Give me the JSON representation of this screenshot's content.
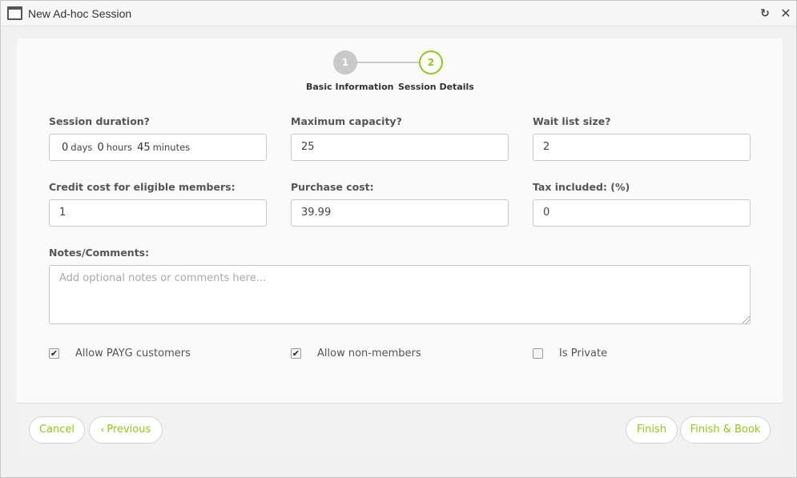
{
  "window": {
    "title": "New Ad-hoc Session",
    "icon": "window-icon",
    "refresh_icon": "refresh-icon",
    "close_icon": "close-icon",
    "refresh_glyph": "↻",
    "close_glyph": "✕"
  },
  "stepper": {
    "steps": [
      {
        "number": "1",
        "label": "Basic Information",
        "state": "complete"
      },
      {
        "number": "2",
        "label": "Session Details",
        "state": "active"
      }
    ],
    "accent_color": "#8ccc10",
    "inactive_color": "#c9c9c9"
  },
  "form": {
    "duration": {
      "label": "Session duration?",
      "days": "0",
      "days_unit": "days",
      "hours": "0",
      "hours_unit": "hours",
      "minutes": "45",
      "minutes_unit": "minutes"
    },
    "max_capacity": {
      "label": "Maximum capacity?",
      "value": "25"
    },
    "wait_list": {
      "label": "Wait list size?",
      "value": "2"
    },
    "credit_cost": {
      "label": "Credit cost for eligible members:",
      "value": "1"
    },
    "purchase_cost": {
      "label": "Purchase cost:",
      "value": "39.99"
    },
    "tax": {
      "label": "Tax included: (%)",
      "value": "0"
    },
    "notes": {
      "label": "Notes/Comments:",
      "placeholder": "Add optional notes or comments here...",
      "value": ""
    },
    "checkboxes": [
      {
        "label": "Allow PAYG customers",
        "checked": true
      },
      {
        "label": "Allow non-members",
        "checked": true
      },
      {
        "label": "Is Private",
        "checked": false
      }
    ],
    "check_glyph": "✔"
  },
  "footer": {
    "cancel": "Cancel",
    "previous": "Previous",
    "previous_chevron": "‹",
    "finish": "Finish",
    "finish_book": "Finish & Book"
  }
}
